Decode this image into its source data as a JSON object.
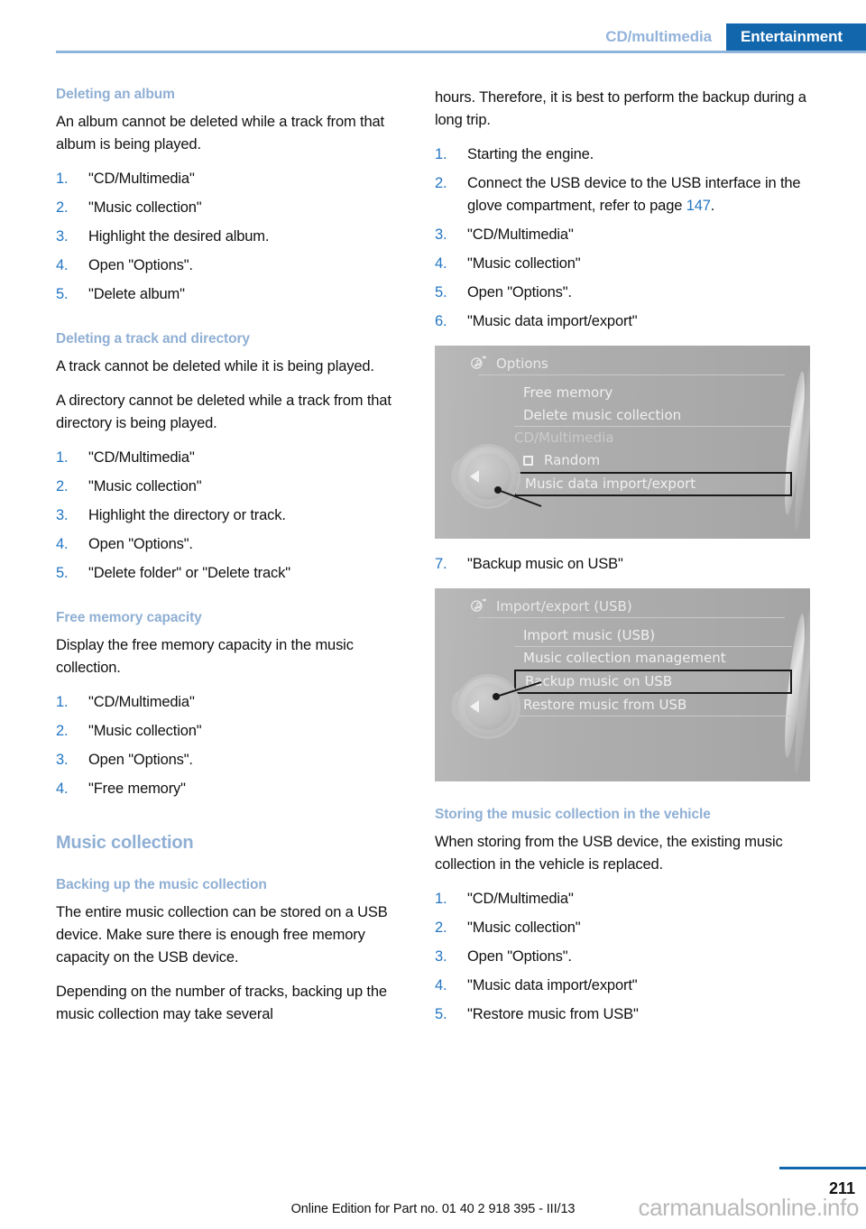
{
  "header": {
    "breadcrumb_secondary": "CD/multimedia",
    "breadcrumb_primary": "Entertainment",
    "accent_color": "#1266AC",
    "rule_color": "#8FB4DC",
    "heading_color": "#8FAFD4",
    "number_color": "#2476C3"
  },
  "left_column": {
    "sections": [
      {
        "title": "Deleting an album",
        "paragraphs": [
          "An album cannot be deleted while a track from that album is being played."
        ],
        "steps": [
          "\"CD/Multimedia\"",
          "\"Music collection\"",
          "Highlight the desired album.",
          "Open \"Options\".",
          "\"Delete album\""
        ]
      },
      {
        "title": "Deleting a track and directory",
        "paragraphs": [
          "A track cannot be deleted while it is being played.",
          "A directory cannot be deleted while a track from that directory is being played."
        ],
        "steps": [
          "\"CD/Multimedia\"",
          "\"Music collection\"",
          "Highlight the directory or track.",
          "Open \"Options\".",
          "\"Delete folder\" or \"Delete track\""
        ]
      },
      {
        "title": "Free memory capacity",
        "paragraphs": [
          "Display the free memory capacity in the music collection."
        ],
        "steps": [
          "\"CD/Multimedia\"",
          "\"Music collection\"",
          "Open \"Options\".",
          "\"Free memory\""
        ]
      }
    ],
    "major_section_title": "Music collection",
    "subsection": {
      "title": "Backing up the music collection",
      "paragraphs": [
        "The entire music collection can be stored on a USB device. Make sure there is enough free memory capacity on the USB device.",
        "Depending on the number of tracks, backing up the music collection may take several"
      ]
    }
  },
  "right_column": {
    "continued_paragraph": "hours. Therefore, it is best to perform the backup during a long trip.",
    "backup_steps": [
      {
        "text": "Starting the engine.",
        "page_ref": null
      },
      {
        "text_before": "Connect the USB device to the USB interface in the glove compartment, refer to page ",
        "page_ref": "147",
        "text_after": "."
      },
      {
        "text": "\"CD/Multimedia\"",
        "page_ref": null
      },
      {
        "text": "\"Music collection\"",
        "page_ref": null
      },
      {
        "text": "Open \"Options\".",
        "page_ref": null
      },
      {
        "text": "\"Music data import/export\"",
        "page_ref": null
      }
    ],
    "screenshot_options": {
      "icon": "music-transfer-icon",
      "title": "Options",
      "rows": [
        {
          "label": "Free memory",
          "type": "item"
        },
        {
          "label": "Delete music collection",
          "type": "item"
        },
        {
          "label": "CD/Multimedia",
          "type": "group"
        },
        {
          "label": "Random",
          "type": "checkbox",
          "checked": false
        },
        {
          "label": "Music data import/export",
          "type": "item",
          "selected": true
        }
      ]
    },
    "step_after_first_image": {
      "number": "7.",
      "text": "\"Backup music on USB\""
    },
    "screenshot_import_export": {
      "icon": "music-transfer-icon",
      "title": "Import/export (USB)",
      "rows": [
        {
          "label": "Import music (USB)",
          "type": "item"
        },
        {
          "label": "Music collection management",
          "type": "item"
        },
        {
          "label": "Backup music on USB",
          "type": "item",
          "selected": true
        },
        {
          "label": "Restore music from USB",
          "type": "item"
        }
      ]
    },
    "storing_section": {
      "title": "Storing the music collection in the vehicle",
      "paragraph": "When storing from the USB device, the existing music collection in the vehicle is replaced.",
      "steps": [
        "\"CD/Multimedia\"",
        "\"Music collection\"",
        "Open \"Options\".",
        "\"Music data import/export\"",
        "\"Restore music from USB\""
      ]
    }
  },
  "footer": {
    "note": "Online Edition for Part no. 01 40 2 918 395 - III/13",
    "page_number": "211",
    "watermark": "carmanualsonline.info"
  }
}
